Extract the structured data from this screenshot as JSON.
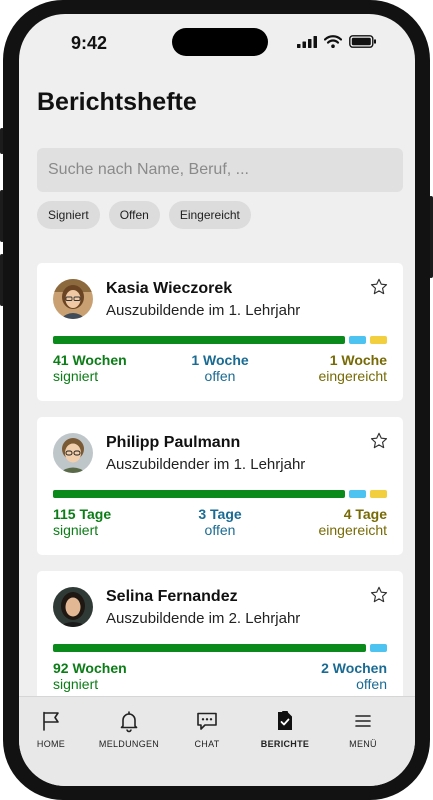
{
  "status_bar": {
    "time": "9:42"
  },
  "page": {
    "title": "Berichtshefte"
  },
  "search": {
    "placeholder": "Suche nach Name, Beruf, ..."
  },
  "filters": [
    "Signiert",
    "Offen",
    "Eingereicht"
  ],
  "cards": [
    {
      "name": "Kasia Wieczorek",
      "role": "Auszubildende im 1. Lehrjahr",
      "progress": {
        "signed_fraction": 0.88,
        "open_fraction": 0.05,
        "submitted_fraction": 0.05
      },
      "stats": {
        "signed_value": "41 Wochen",
        "signed_label": "signiert",
        "open_value": "1 Woche",
        "open_label": "offen",
        "submitted_value": "1 Woche",
        "submitted_label": "eingereicht"
      }
    },
    {
      "name": "Philipp Paulmann",
      "role": "Auszubildender im 1. Lehrjahr",
      "progress": {
        "signed_fraction": 0.88,
        "open_fraction": 0.05,
        "submitted_fraction": 0.05
      },
      "stats": {
        "signed_value": "115 Tage",
        "signed_label": "signiert",
        "open_value": "3 Tage",
        "open_label": "offen",
        "submitted_value": "4 Tage",
        "submitted_label": "eingereicht"
      }
    },
    {
      "name": "Selina Fernandez",
      "role": "Auszubildende im 2. Lehrjahr",
      "progress": {
        "signed_fraction": 0.94,
        "open_fraction": 0.05
      },
      "stats": {
        "signed_value": "92 Wochen",
        "signed_label": "signiert",
        "open_value": "2 Wochen",
        "open_label": "offen"
      }
    }
  ],
  "tabbar": {
    "items": [
      {
        "label": "HOME",
        "icon": "flag-icon"
      },
      {
        "label": "MELDUNGEN",
        "icon": "bell-icon"
      },
      {
        "label": "CHAT",
        "icon": "chat-bubble-icon"
      },
      {
        "label": "BERICHTE",
        "icon": "document-check-icon",
        "active": true
      },
      {
        "label": "MENÜ",
        "icon": "hamburger-menu-icon"
      }
    ]
  },
  "colors": {
    "signed": "#0a8a1a",
    "open": "#4cc3f0",
    "submitted": "#f2cf3e",
    "screen_bg": "#efefef"
  }
}
